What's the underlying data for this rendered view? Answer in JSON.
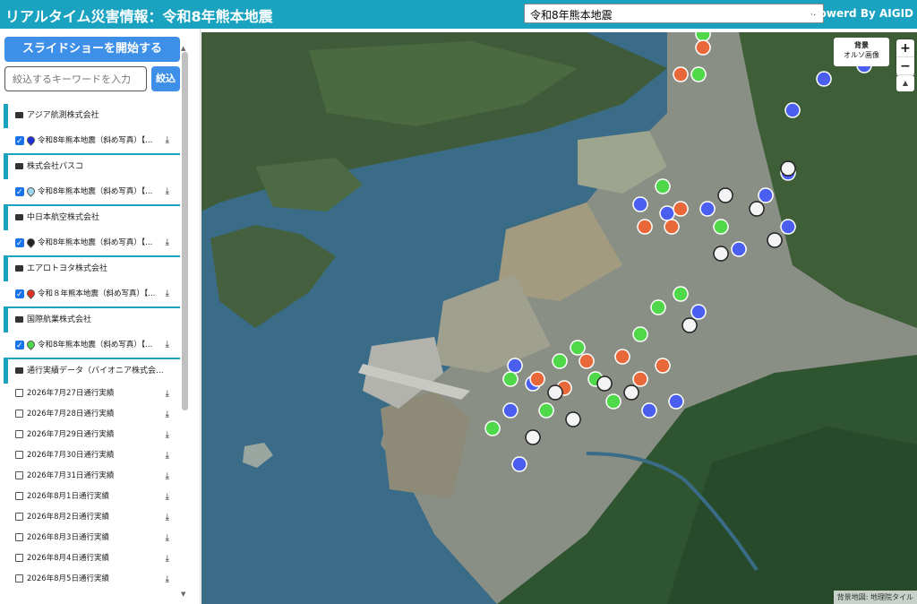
{
  "header": {
    "title": "リアルタイム災害情報：令和8年熊本地震",
    "event_select": "令和8年熊本地震",
    "powered": "Powerd By AIGID"
  },
  "sidebar": {
    "slideshow_label": "スライドショーを開始する",
    "search_placeholder": "絞込するキーワードを入力",
    "filter_label": "絞込",
    "groups": [
      {
        "name": "アジア航測株式会社",
        "layer": "令和8年熊本地震（斜め写真）【...",
        "pin_color": "#1c2fd9"
      },
      {
        "name": "株式会社パスコ",
        "layer": "令和8年熊本地震（斜め写真）【...",
        "pin_color": "#9bd6ee"
      },
      {
        "name": "中日本航空株式会社",
        "layer": "令和8年熊本地震（斜め写真）【...",
        "pin_color": "#222222"
      },
      {
        "name": "エアロトヨタ株式会社",
        "layer": "令和８年熊本地震（斜め写真）【...",
        "pin_color": "#e03020"
      },
      {
        "name": "国際航業株式会社",
        "layer": "令和8年熊本地震（斜め写真）【...",
        "pin_color": "#4fd84a"
      }
    ],
    "route_group": "通行実績データ（パイオニア株式会...",
    "routes": [
      "2026年7月27日通行実績",
      "2026年7月28日通行実績",
      "2026年7月29日通行実績",
      "2026年7月30日通行実績",
      "2026年7月31日通行実績",
      "2026年8月1日通行実績",
      "2026年8月2日通行実績",
      "2026年8月3日通行実績",
      "2026年8月4日通行実績",
      "2026年8月5日通行実績"
    ]
  },
  "map": {
    "bg_label": "背景",
    "bg_value": "オルソ画像",
    "zoom_in": "+",
    "zoom_out": "−",
    "compass": "▲",
    "attribution": "背景地図: 地理院タイル"
  }
}
